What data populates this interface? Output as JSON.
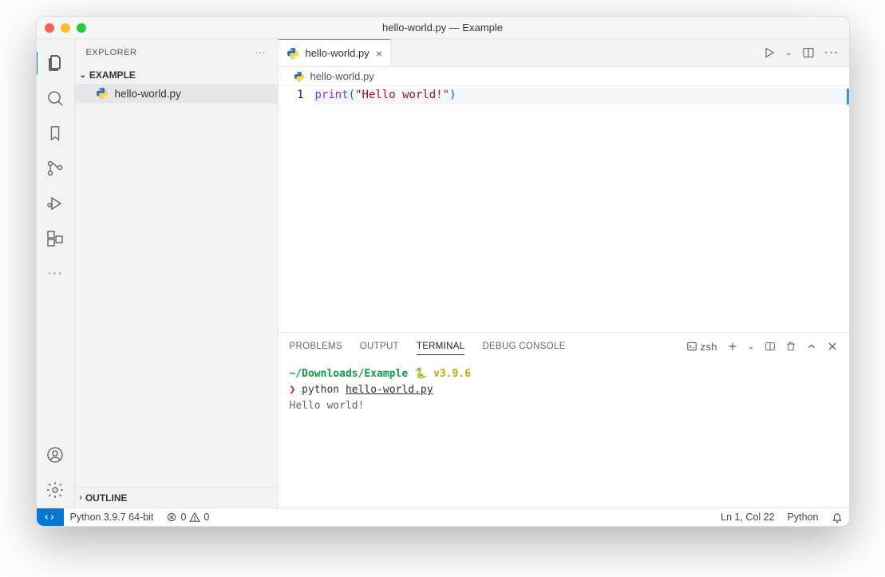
{
  "window": {
    "title": "hello-world.py — Example"
  },
  "sidebar": {
    "header": "EXPLORER",
    "section": "EXAMPLE",
    "files": [
      {
        "name": "hello-world.py"
      }
    ],
    "outline": "OUTLINE"
  },
  "tabs": {
    "active": {
      "name": "hello-world.py"
    }
  },
  "breadcrumb": {
    "file": "hello-world.py"
  },
  "editor": {
    "line1_number": "1",
    "line1_fn": "print",
    "line1_open": "(",
    "line1_str": "\"Hello world!\"",
    "line1_close": ")"
  },
  "panel": {
    "tabs": {
      "problems": "PROBLEMS",
      "output": "OUTPUT",
      "terminal": "TERMINAL",
      "debug": "DEBUG CONSOLE"
    },
    "shell": "zsh"
  },
  "terminal": {
    "path": "~/Downloads/Example",
    "snake": "🐍",
    "version": "v3.9.6",
    "prompt": "❯",
    "command": "python",
    "cmd_file": "hello-world.py",
    "output": "Hello world!"
  },
  "status": {
    "interpreter": "Python 3.9.7 64-bit",
    "errors": "0",
    "warnings": "0",
    "cursor": "Ln 1, Col 22",
    "language": "Python"
  }
}
